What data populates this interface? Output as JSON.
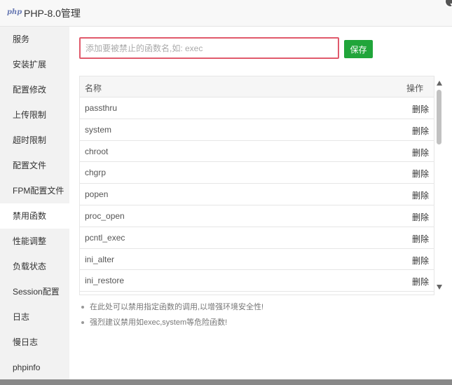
{
  "window": {
    "logo": "php",
    "title": "PHP-8.0管理"
  },
  "sidebar": {
    "items": [
      {
        "label": "服务"
      },
      {
        "label": "安装扩展"
      },
      {
        "label": "配置修改"
      },
      {
        "label": "上传限制"
      },
      {
        "label": "超时限制"
      },
      {
        "label": "配置文件"
      },
      {
        "label": "FPM配置文件"
      },
      {
        "label": "禁用函数"
      },
      {
        "label": "性能调整"
      },
      {
        "label": "负载状态"
      },
      {
        "label": "Session配置"
      },
      {
        "label": "日志"
      },
      {
        "label": "慢日志"
      },
      {
        "label": "phpinfo"
      }
    ],
    "active": "禁用函数"
  },
  "form": {
    "input_value": "",
    "input_placeholder": "添加要被禁止的函数名,如: exec",
    "save_label": "保存"
  },
  "table": {
    "col_name": "名称",
    "col_op": "操作",
    "rows": [
      {
        "name": "passthru",
        "op": "删除"
      },
      {
        "name": "system",
        "op": "删除"
      },
      {
        "name": "chroot",
        "op": "删除"
      },
      {
        "name": "chgrp",
        "op": "删除"
      },
      {
        "name": "popen",
        "op": "删除"
      },
      {
        "name": "proc_open",
        "op": "删除"
      },
      {
        "name": "pcntl_exec",
        "op": "删除"
      },
      {
        "name": "ini_alter",
        "op": "删除"
      },
      {
        "name": "ini_restore",
        "op": "删除"
      }
    ]
  },
  "tips": [
    "在此处可以禁用指定函数的调用,以增强环境安全性!",
    "强烈建议禁用如exec,system等危险函数!"
  ],
  "colors": {
    "accent": "#20a53a",
    "input_border": "#e05a6c"
  }
}
